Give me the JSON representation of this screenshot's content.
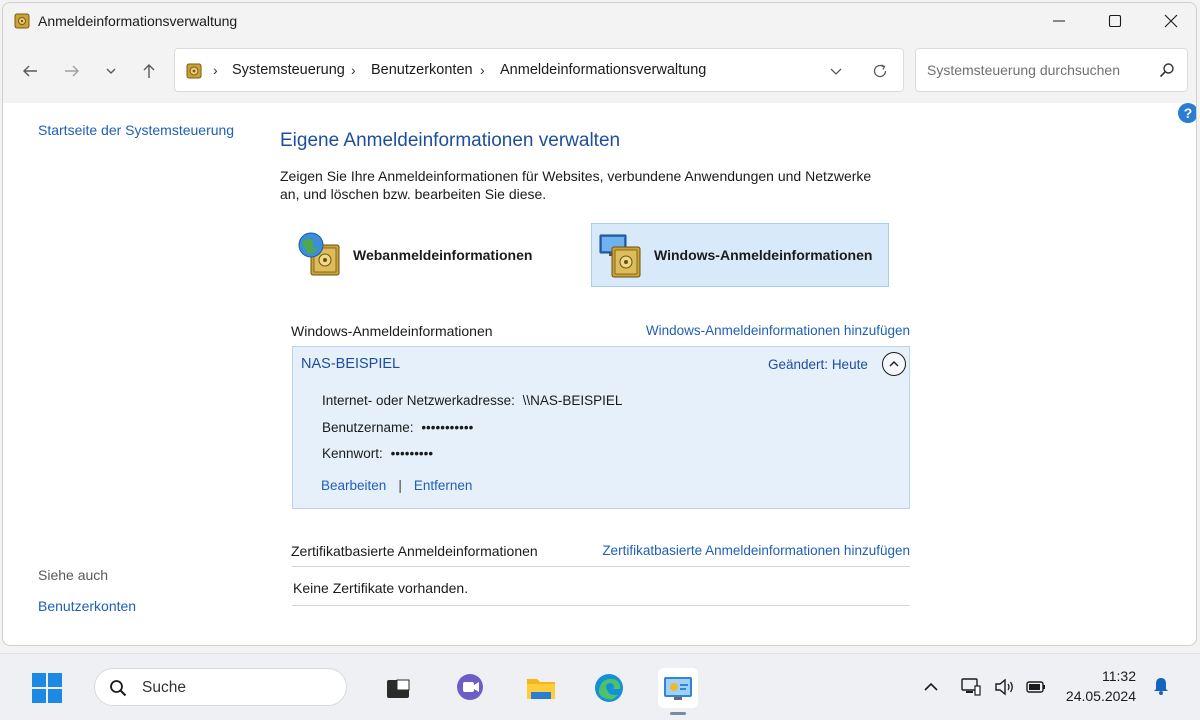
{
  "window": {
    "title": "Anmeldeinformationsverwaltung"
  },
  "addressbar": {
    "crumbs": [
      "Systemsteuerung",
      "Benutzerkonten",
      "Anmeldeinformationsverwaltung"
    ]
  },
  "search": {
    "placeholder": "Systemsteuerung durchsuchen"
  },
  "leftnav": {
    "home": "Startseite der Systemsteuerung",
    "see_also": "Siehe auch",
    "user_accounts": "Benutzerkonten"
  },
  "main": {
    "title": "Eigene Anmeldeinformationen verwalten",
    "description": "Zeigen Sie Ihre Anmeldeinformationen für Websites, verbundene Anwendungen und Netzwerke an, und löschen bzw. bearbeiten Sie diese.",
    "web_credentials": "Webanmeldeinformationen",
    "windows_credentials": "Windows-Anmeldeinformationen"
  },
  "windows_section": {
    "heading": "Windows-Anmeldeinformationen",
    "add_link": "Windows-Anmeldeinformationen hinzufügen",
    "entry": {
      "name": "NAS-BEISPIEL",
      "changed_label": "Geändert:",
      "changed_value": "Heute",
      "address_label": "Internet- oder Netzwerkadresse:",
      "address_value": "\\\\NAS-BEISPIEL",
      "username_label": "Benutzername:",
      "username_value": "•••••••••••",
      "password_label": "Kennwort:",
      "password_value": "•••••••••",
      "edit": "Bearbeiten",
      "remove": "Entfernen",
      "separator": "|"
    }
  },
  "certificate_section": {
    "heading": "Zertifikatbasierte Anmeldeinformationen",
    "add_link": "Zertifikatbasierte Anmeldeinformationen hinzufügen",
    "empty_text": "Keine Zertifikate vorhanden."
  },
  "taskbar": {
    "search_label": "Suche",
    "time": "11:32",
    "date": "24.05.2024"
  },
  "colors": {
    "link": "#1f5fb8",
    "heading": "#1e4e9b",
    "selected_bg": "#d8eafa"
  }
}
